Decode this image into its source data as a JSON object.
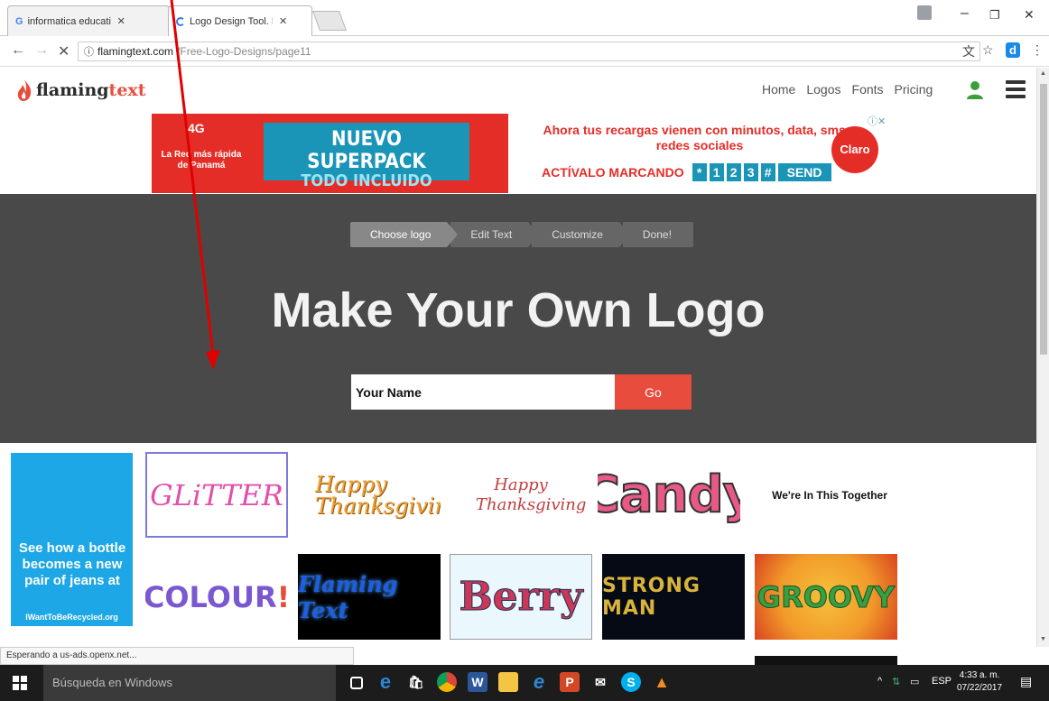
{
  "browser": {
    "tabs": [
      {
        "title": "informatica educativa - Búsqueda",
        "close": "✕"
      },
      {
        "title": "Logo Design Tool. Free and",
        "close": "✕"
      }
    ],
    "url_host": "flamingtext.com",
    "url_path": "/Free-Logo-Designs/page11",
    "status_text": "Esperando a us-ads.openx.net..."
  },
  "site": {
    "logo_text_main": "flaming",
    "logo_text_accent": "text",
    "nav": [
      "Home",
      "Logos",
      "Fonts",
      "Pricing"
    ]
  },
  "ad": {
    "badge": "4G",
    "tagline": "La Red más rápida de Panamá",
    "headline": "NUEVO SUPERPACK",
    "subline": "TODO INCLUIDO",
    "right_text": "Ahora tus recargas vienen con minutos, data, sms y redes sociales",
    "call_label": "ACTÍVALO MARCANDO",
    "keys": [
      "*",
      "1",
      "2",
      "3",
      "#",
      "SEND"
    ],
    "brand": "Claro"
  },
  "hero": {
    "steps": [
      "Choose logo",
      "Edit Text",
      "Customize",
      "Done!"
    ],
    "title": "Make Your Own Logo",
    "input_placeholder": "Your Name",
    "go_label": "Go"
  },
  "gallery": {
    "side_ad_text": "See how a bottle becomes a new pair of jeans at",
    "side_ad_url": "IWantToBeRecycled.org",
    "logos": {
      "glitter": "GLiTTER",
      "happy1": "Happy Thanksgiving",
      "happy2": "Happy Thanksgiving",
      "candy": "Candy",
      "together": "We're In This Together",
      "colour_main": "COLOUR",
      "colour_accent": "!",
      "flaming": "Flaming Text",
      "berry": "Berry",
      "strong": "STRONG MAN",
      "groovy": "GROOVY"
    }
  },
  "taskbar": {
    "search_placeholder": "Búsqueda en Windows",
    "lang": "ESP",
    "time": "4:33 a. m.",
    "date": "07/22/2017"
  },
  "colors": {
    "brand_red": "#e84c3d",
    "hero_bg": "#494949",
    "annotation_arrow": "#e00000"
  }
}
